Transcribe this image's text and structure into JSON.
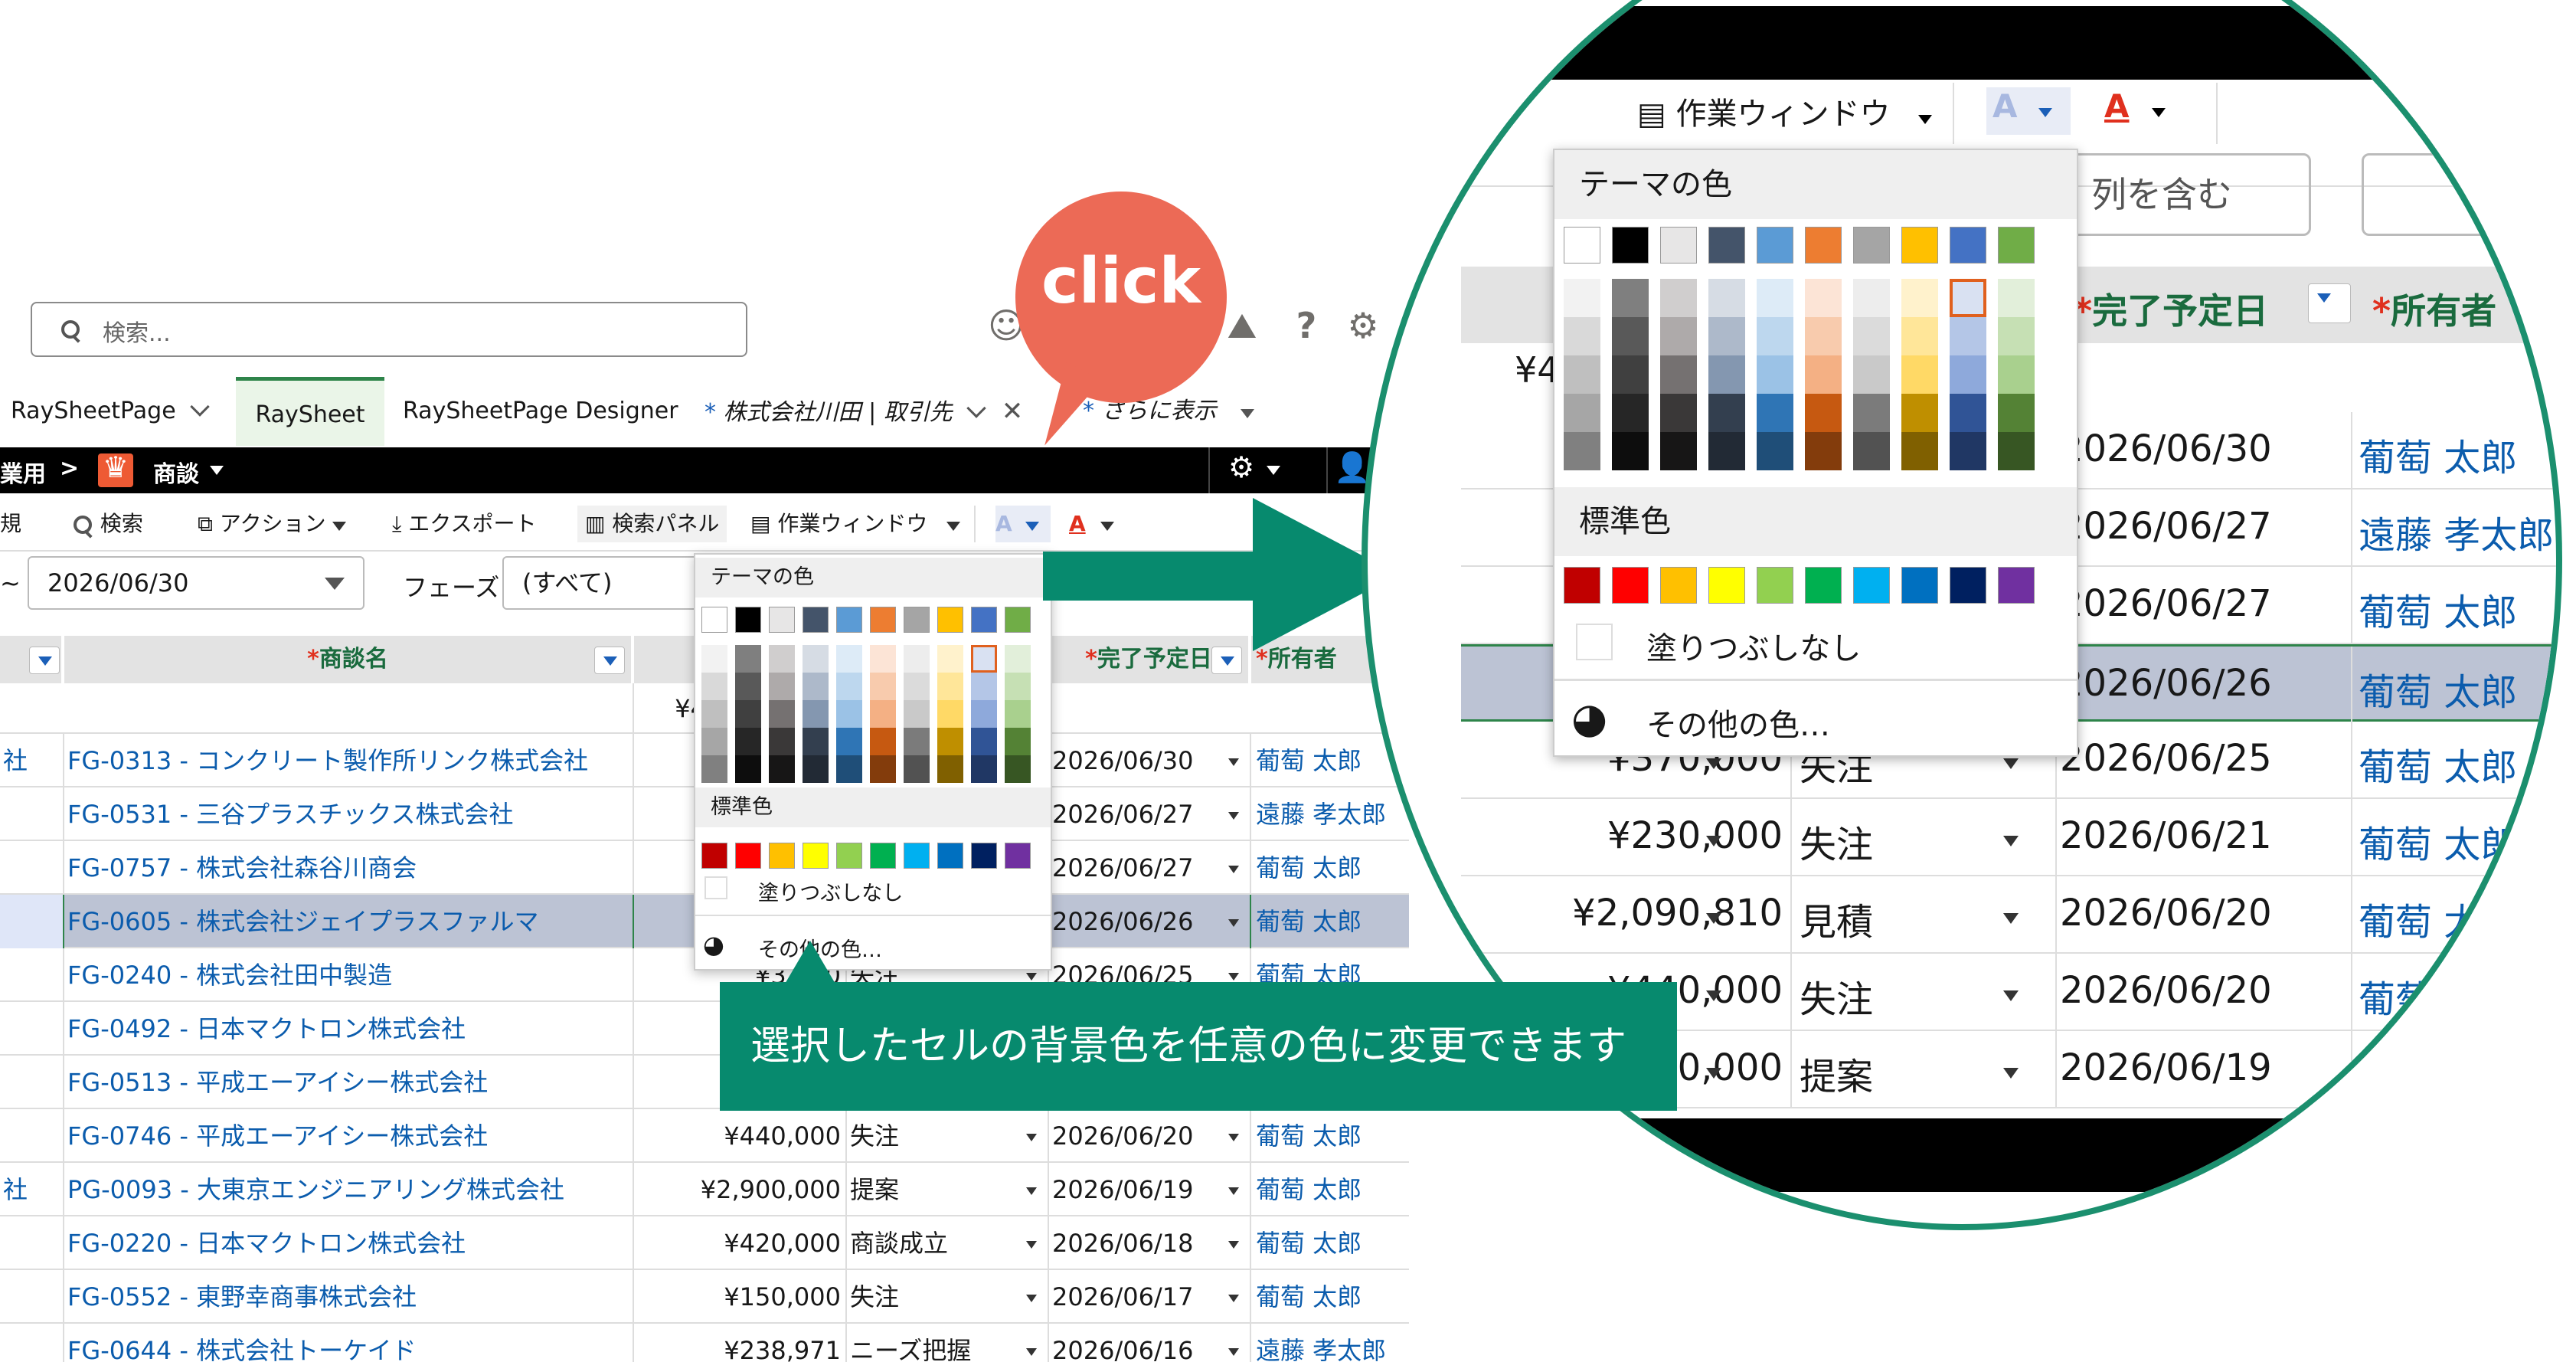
{
  "search": {
    "placeholder": "検索..."
  },
  "header_icons": {
    "bot": "astro-bot-icon",
    "help": "?",
    "settings": "gear-icon",
    "trail": "trailhead-icon"
  },
  "tabs": [
    {
      "label": "RaySheetPage"
    },
    {
      "label": "RaySheet"
    },
    {
      "label": "RaySheetPage Designer"
    },
    {
      "label": "株式会社川田 | 取引先"
    },
    {
      "label": "さらに表示"
    }
  ],
  "blackbar": {
    "app": "業用",
    "sep": ">",
    "object": "商談"
  },
  "toolbar": {
    "view": "規",
    "search": "検索",
    "action": "アクション",
    "export": "エクスポート",
    "search_panel": "検索パネル",
    "work_window": "作業ウィンドウ"
  },
  "filters": {
    "prefix": "~",
    "date": "2026/06/30",
    "phase_label": "フェーズ:",
    "phase_value": "(すべて)",
    "column_filter": "列を含む"
  },
  "grid": {
    "headers": {
      "deal": "商談名",
      "due": "完了予定日",
      "owner": "所有者"
    },
    "header_star": "*",
    "amount_total": "¥4",
    "rows": [
      {
        "left": "社",
        "deal": "FG-0313 - コンクリート製作所リンク株式会社",
        "amount": "¥4",
        "phase": "",
        "date": "2026/06/30",
        "owner": "葡萄 太郎"
      },
      {
        "left": "",
        "deal": "FG-0531 - 三谷プラスチックス株式会社",
        "amount": "",
        "phase": "",
        "date": "2026/06/27",
        "owner": "遠藤 孝太郎"
      },
      {
        "left": "",
        "deal": "FG-0757 - 株式会社森谷川商会",
        "amount": "",
        "phase": "",
        "date": "2026/06/27",
        "owner": "葡萄 太郎"
      },
      {
        "left": "",
        "deal": "FG-0605 - 株式会社ジェイプラスファルマ",
        "amount": "¥",
        "phase": "",
        "date": "2026/06/26",
        "owner": "葡萄 太郎"
      },
      {
        "left": "",
        "deal": "FG-0240 - 株式会社田中製造",
        "amount": "¥370,0",
        "phase": "失注",
        "date": "2026/06/25",
        "owner": "葡萄 太郎"
      },
      {
        "left": "",
        "deal": "FG-0492 - 日本マクトロン株式会社",
        "amount": "",
        "phase": "",
        "date": "2026/06/21",
        "owner": "葡萄 太郎"
      },
      {
        "left": "",
        "deal": "FG-0513 - 平成エーアイシー株式会社",
        "amount": "¥2,",
        "phase": "",
        "date": "2026/06/20",
        "owner": "葡萄 太郎"
      },
      {
        "left": "",
        "deal": "FG-0746 - 平成エーアイシー株式会社",
        "amount": "¥440,000",
        "phase": "失注",
        "date": "2026/06/20",
        "owner": "葡萄 太郎"
      },
      {
        "left": "社",
        "deal": "PG-0093 - 大東京エンジニアリング株式会社",
        "amount": "¥2,900,000",
        "phase": "提案",
        "date": "2026/06/19",
        "owner": "葡萄 太郎"
      },
      {
        "left": "",
        "deal": "FG-0220 - 日本マクトロン株式会社",
        "amount": "¥420,000",
        "phase": "商談成立",
        "date": "2026/06/18",
        "owner": "葡萄 太郎"
      },
      {
        "left": "",
        "deal": "FG-0552 - 東野幸商事株式会社",
        "amount": "¥150,000",
        "phase": "失注",
        "date": "2026/06/17",
        "owner": "葡萄 太郎"
      },
      {
        "left": "",
        "deal": "FG-0644 - 株式会社トーケイド",
        "amount": "¥238,971",
        "phase": "ニーズ把握",
        "date": "2026/06/16",
        "owner": "遠藤 孝太郎"
      }
    ]
  },
  "zoom_rows": [
    {
      "amount": "¥",
      "phase": "",
      "date": "2026/06/30",
      "owner": "葡萄 太郎"
    },
    {
      "amount": "¥",
      "phase": "",
      "date": "2026/06/27",
      "owner": "遠藤 孝太郎"
    },
    {
      "amount": "¥",
      "phase": "",
      "date": "2026/06/27",
      "owner": "葡萄 太郎"
    },
    {
      "amount": "¥",
      "phase": "",
      "date": "2026/06/26",
      "owner": "葡萄 太郎"
    },
    {
      "amount": "¥370,000",
      "phase": "失注",
      "date": "2026/06/25",
      "owner": "葡萄 太郎"
    },
    {
      "amount": "¥230,000",
      "phase": "失注",
      "date": "2026/06/21",
      "owner": "葡萄 太郎"
    },
    {
      "amount": "¥2,090,810",
      "phase": "見積",
      "date": "2026/06/20",
      "owner": "葡萄 太郎"
    },
    {
      "amount": "¥440,000",
      "phase": "失注",
      "date": "2026/06/20",
      "owner": "葡萄 太郎"
    },
    {
      "amount": "¥2,900,000",
      "phase": "提案",
      "date": "2026/06/19",
      "owner": "葡萄 太郎"
    }
  ],
  "color_popup": {
    "theme_title": "テーマの色",
    "standard_title": "標準色",
    "no_fill": "塗りつぶしなし",
    "more_colors": "その他の色…",
    "theme_top": [
      "#ffffff",
      "#000000",
      "#e7e6e6",
      "#44546a",
      "#5b9bd5",
      "#ed7d31",
      "#a5a5a5",
      "#ffc000",
      "#4472c4",
      "#70ad47"
    ],
    "theme_shades": [
      [
        "#f2f2f2",
        "#d9d9d9",
        "#bfbfbf",
        "#a6a6a6",
        "#808080"
      ],
      [
        "#7f7f7f",
        "#595959",
        "#404040",
        "#262626",
        "#0d0d0d"
      ],
      [
        "#d0cece",
        "#aeaaaa",
        "#757171",
        "#3a3838",
        "#171616"
      ],
      [
        "#d6dce4",
        "#adb9ca",
        "#8497b0",
        "#333f4f",
        "#222a35"
      ],
      [
        "#ddebf7",
        "#bdd7ee",
        "#9bc2e6",
        "#2f75b5",
        "#1f4e78"
      ],
      [
        "#fce4d6",
        "#f8cbad",
        "#f4b084",
        "#c65911",
        "#833c0c"
      ],
      [
        "#ededed",
        "#dbdbdb",
        "#c9c9c9",
        "#7b7b7b",
        "#525252"
      ],
      [
        "#fff2cc",
        "#ffe699",
        "#ffd966",
        "#bf8f00",
        "#806000"
      ],
      [
        "#d9e1f2",
        "#b4c6e7",
        "#8ea9db",
        "#305496",
        "#203764"
      ],
      [
        "#e2efda",
        "#c6e0b4",
        "#a9d08e",
        "#548235",
        "#375623"
      ]
    ],
    "standard": [
      "#c00000",
      "#ff0000",
      "#ffc000",
      "#ffff00",
      "#92d050",
      "#00b050",
      "#00b0f0",
      "#0070c0",
      "#002060",
      "#7030a0"
    ]
  },
  "callout": {
    "click": "click",
    "caption": "選択したセルの背景色を任意の色に変更できます"
  },
  "colors": {
    "accent": "#078a6e",
    "bubble": "#ec6a56",
    "link": "#0b5cad",
    "header_text": "#1a6b3e",
    "selected_row": "#bcc3d4"
  }
}
